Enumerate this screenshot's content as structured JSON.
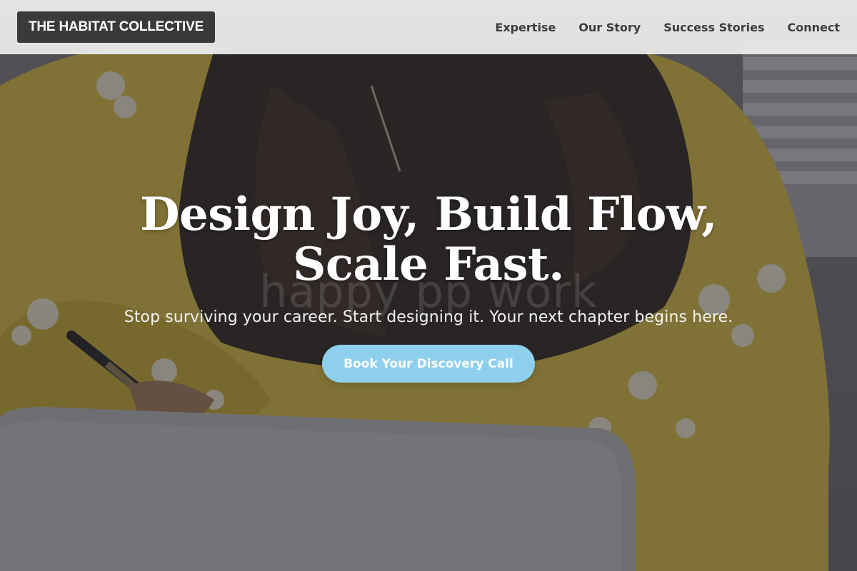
{
  "nav": {
    "logo": "THE HABITAT COLLECTIVE",
    "links": [
      "Expertise",
      "Our Story",
      "Success Stories",
      "Connect"
    ]
  },
  "hero": {
    "headline": "Design Joy, Build Flow, Scale Fast.",
    "subheadline": "Stop surviving your career. Start designing it. Your next chapter begins here.",
    "cta_label": "Book Your Discovery Call",
    "background_image": "woman in yellow floral top writing at laptop",
    "watermark_text": "happy pp work"
  },
  "colors": {
    "nav_background": "#eeeeee",
    "logo_background": "#3a3a3c",
    "cta_background": "#8ecfee",
    "headline_text": "#ffffff"
  }
}
